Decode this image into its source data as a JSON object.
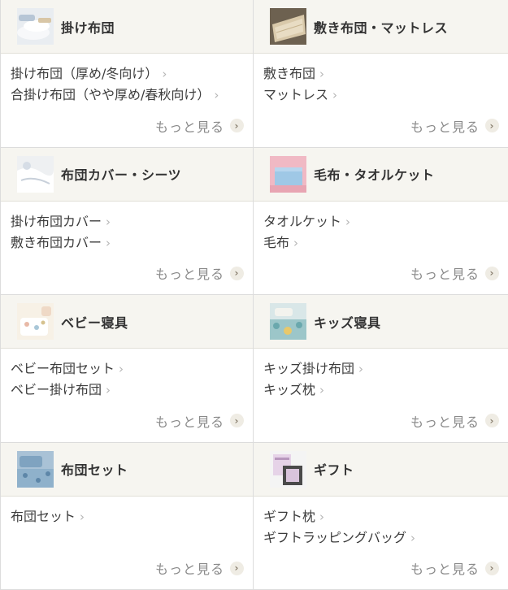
{
  "categories": [
    {
      "title": "掛け布団",
      "thumb_icon": "comforter-photo-icon",
      "links": [
        {
          "label": "掛け布団（厚め/冬向け）"
        },
        {
          "label": "合掛け布団（やや厚め/春秋向け）"
        }
      ],
      "more_label": "もっと見る"
    },
    {
      "title": "敷き布団・マットレス",
      "thumb_icon": "mattress-photo-icon",
      "links": [
        {
          "label": "敷き布団"
        },
        {
          "label": "マットレス"
        }
      ],
      "more_label": "もっと見る"
    },
    {
      "title": "布団カバー・シーツ",
      "thumb_icon": "cover-sheet-photo-icon",
      "links": [
        {
          "label": "掛け布団カバー"
        },
        {
          "label": "敷き布団カバー"
        }
      ],
      "more_label": "もっと見る"
    },
    {
      "title": "毛布・タオルケット",
      "thumb_icon": "blanket-photo-icon",
      "links": [
        {
          "label": "タオルケット"
        },
        {
          "label": "毛布"
        }
      ],
      "more_label": "もっと見る"
    },
    {
      "title": "ベビー寝具",
      "thumb_icon": "baby-bedding-photo-icon",
      "links": [
        {
          "label": "ベビー布団セット"
        },
        {
          "label": "ベビー掛け布団"
        }
      ],
      "more_label": "もっと見る"
    },
    {
      "title": "キッズ寝具",
      "thumb_icon": "kids-bedding-photo-icon",
      "links": [
        {
          "label": "キッズ掛け布団"
        },
        {
          "label": "キッズ枕"
        }
      ],
      "more_label": "もっと見る"
    },
    {
      "title": "布団セット",
      "thumb_icon": "futon-set-photo-icon",
      "links": [
        {
          "label": "布団セット"
        }
      ],
      "more_label": "もっと見る"
    },
    {
      "title": "ギフト",
      "thumb_icon": "gift-photo-icon",
      "links": [
        {
          "label": "ギフト枕"
        },
        {
          "label": "ギフトラッピングバッグ"
        }
      ],
      "more_label": "もっと見る"
    }
  ],
  "link_chevron": "›",
  "more_chevron": "›",
  "colors": {
    "header_bg": "#f6f5f0",
    "border": "#dcdcdc",
    "text": "#3c3c3c",
    "more_text": "#8a8a8a",
    "more_circle": "#efece4"
  }
}
